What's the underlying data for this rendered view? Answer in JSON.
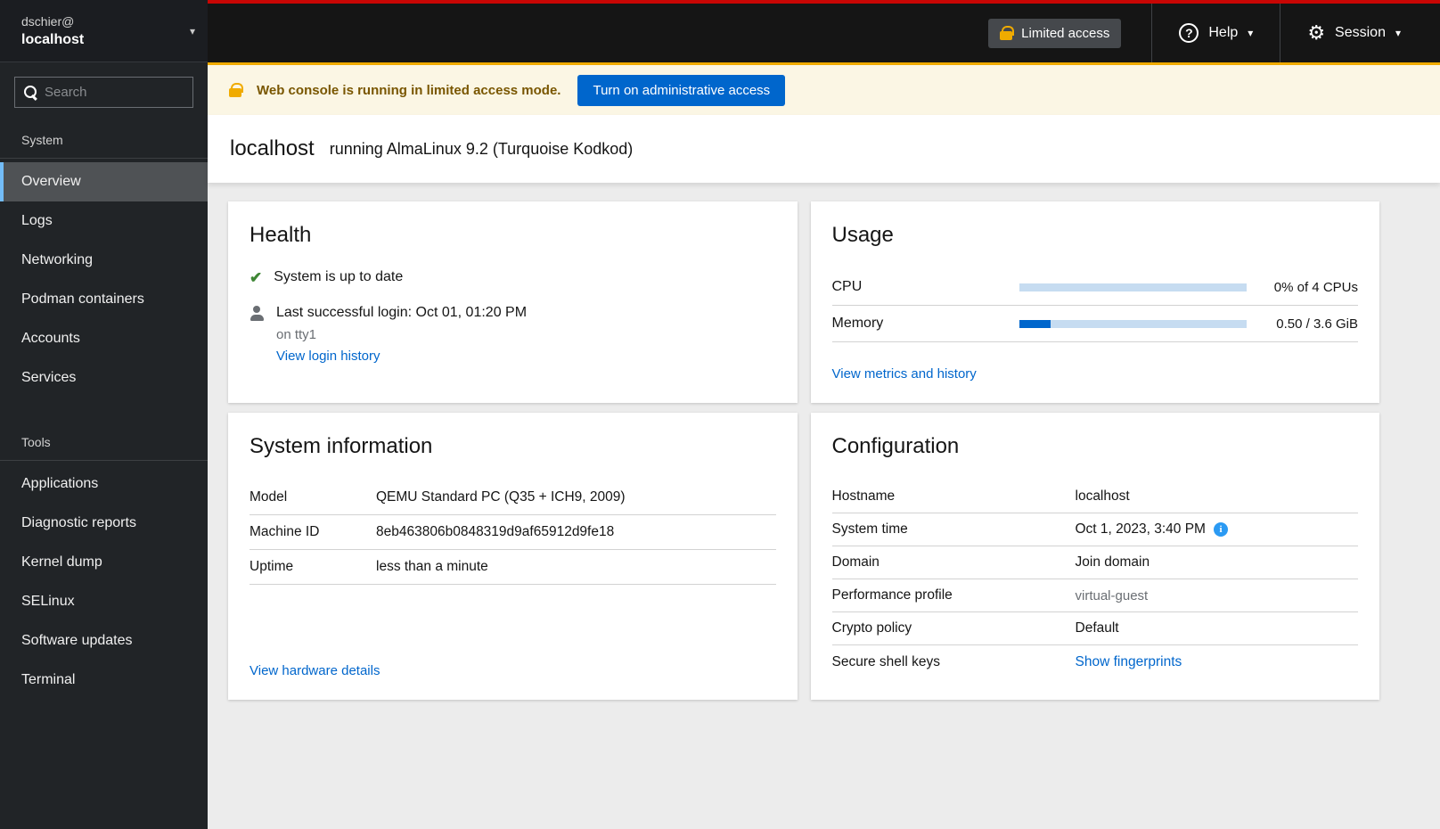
{
  "masthead": {
    "limited_access_label": "Limited access",
    "help_label": "Help",
    "session_label": "Session"
  },
  "sidebar": {
    "user": "dschier@",
    "host": "localhost",
    "search_placeholder": "Search",
    "sections": [
      {
        "label": "System",
        "items": [
          "Overview",
          "Logs",
          "Networking",
          "Podman containers",
          "Accounts",
          "Services"
        ]
      },
      {
        "label": "Tools",
        "items": [
          "Applications",
          "Diagnostic reports",
          "Kernel dump",
          "SELinux",
          "Software updates",
          "Terminal"
        ]
      }
    ]
  },
  "banner": {
    "message": "Web console is running in limited access mode.",
    "button_label": "Turn on administrative access"
  },
  "page": {
    "hostname": "localhost",
    "subtitle": "running AlmaLinux 9.2 (Turquoise Kodkod)"
  },
  "health": {
    "title": "Health",
    "status": "System is up to date",
    "last_login": "Last successful login: Oct 01, 01:20 PM",
    "last_login_detail": "on tty1",
    "link": "View login history"
  },
  "usage": {
    "title": "Usage",
    "rows": [
      {
        "label": "CPU",
        "value": "0% of 4 CPUs",
        "percent": 0
      },
      {
        "label": "Memory",
        "value": "0.50 / 3.6 GiB",
        "percent": 14
      }
    ],
    "link": "View metrics and history"
  },
  "system_info": {
    "title": "System information",
    "rows": [
      {
        "label": "Model",
        "value": "QEMU Standard PC (Q35 + ICH9, 2009)"
      },
      {
        "label": "Machine ID",
        "value": "8eb463806b0848319d9af65912d9fe18"
      },
      {
        "label": "Uptime",
        "value": "less than a minute"
      }
    ],
    "link": "View hardware details"
  },
  "configuration": {
    "title": "Configuration",
    "rows": [
      {
        "label": "Hostname",
        "value": "localhost"
      },
      {
        "label": "System time",
        "value": "Oct 1, 2023, 3:40 PM"
      },
      {
        "label": "Domain",
        "value": "Join domain"
      },
      {
        "label": "Performance profile",
        "value": "virtual-guest"
      },
      {
        "label": "Crypto policy",
        "value": "Default"
      },
      {
        "label": "Secure shell keys",
        "value": "Show fingerprints"
      }
    ],
    "info_icon_label": "i"
  },
  "colors": {
    "accent_red": "#c80604",
    "warning_gold": "#f0ab00",
    "link_blue": "#0066cc",
    "nav_active_blue": "#73bcf7",
    "success_green": "#3e8635",
    "info_blue": "#2b9af3",
    "memory_bar_fill": "#0066cc",
    "bar_track": "#c6dcf1"
  }
}
